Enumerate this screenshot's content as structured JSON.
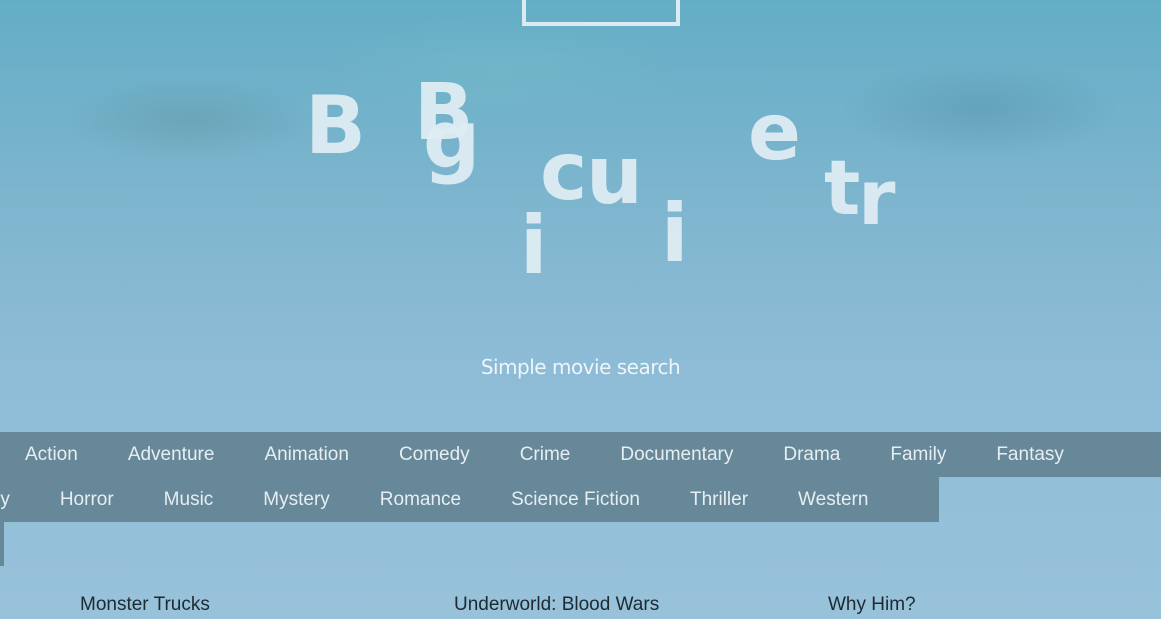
{
  "logo": {
    "letters": [
      "B",
      "B",
      "g",
      "c",
      "u",
      "e",
      "t",
      "r",
      "i",
      "i"
    ]
  },
  "tagline": "Simple movie search",
  "genres": {
    "row1": [
      "Action",
      "Adventure",
      "Animation",
      "Comedy",
      "Crime",
      "Documentary",
      "Drama",
      "Family",
      "Fantasy"
    ],
    "row2": [
      "ry",
      "Horror",
      "Music",
      "Mystery",
      "Romance",
      "Science Fiction",
      "Thriller",
      "Western"
    ]
  },
  "movies": [
    "Monster Trucks",
    "Underworld: Blood Wars",
    "Why Him?"
  ]
}
